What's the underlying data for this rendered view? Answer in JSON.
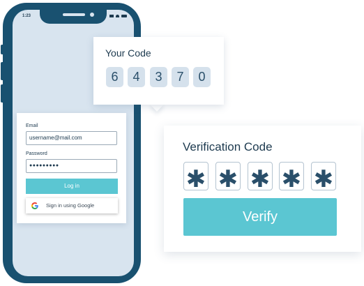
{
  "phone": {
    "status_time": "1:23"
  },
  "login_form": {
    "email_label": "Email",
    "email_value": "username@mail.com",
    "password_label": "Password",
    "password_value": "●●●●●●●●●",
    "login_button": "Log in",
    "google_button": "Sign in using Google"
  },
  "code_popup": {
    "title": "Your Code",
    "digits": [
      "6",
      "4",
      "3",
      "7",
      "0"
    ]
  },
  "verification": {
    "title": "Verification Code",
    "inputs": [
      "✱",
      "✱",
      "✱",
      "✱",
      "✱"
    ],
    "verify_button": "Verify"
  },
  "colors": {
    "phone_frame": "#195170",
    "screen_bg": "#d8e4ef",
    "accent": "#5bc6d2",
    "text": "#1d3a4f"
  },
  "icons": {
    "google": "google-icon"
  }
}
